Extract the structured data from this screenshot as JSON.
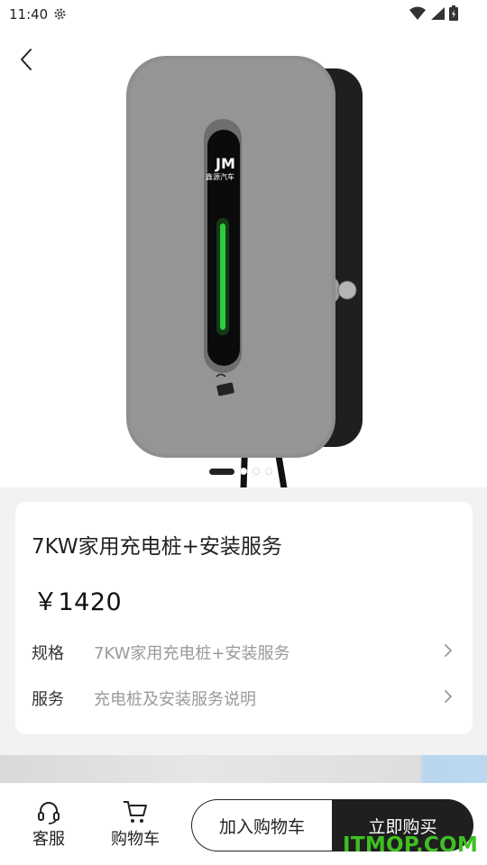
{
  "status_bar": {
    "time": "11:40"
  },
  "product": {
    "logo_text": "鑫源汽车",
    "title": "7KW家用充电桩+安装服务",
    "price": "￥1420",
    "specs": [
      {
        "label": "规格",
        "value": "7KW家用充电桩+安装服务"
      },
      {
        "label": "服务",
        "value": "充电桩及安装服务说明"
      }
    ],
    "carousel": {
      "count": 4,
      "active_index": 0
    }
  },
  "bottom_bar": {
    "service_label": "客服",
    "cart_label": "购物车",
    "add_to_cart_label": "加入购物车",
    "buy_now_label": "立即购买"
  },
  "watermark": "ITMOP.COM",
  "colors": {
    "accent": "#1f1f1f",
    "charger_led": "#2ecc40",
    "watermark": "#3ec020"
  }
}
